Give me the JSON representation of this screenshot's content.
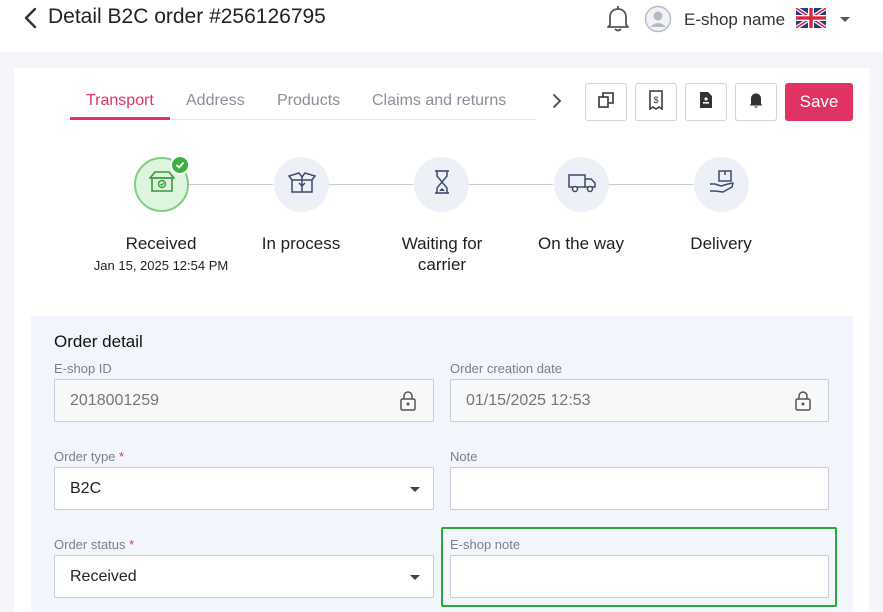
{
  "header": {
    "title": "Detail B2C order #256126795",
    "eshop_name": "E-shop name",
    "language_flag": "uk-flag-icon"
  },
  "tabs": [
    {
      "label": "Transport",
      "active": true
    },
    {
      "label": "Address",
      "active": false
    },
    {
      "label": "Products",
      "active": false
    },
    {
      "label": "Claims and returns",
      "active": false
    }
  ],
  "toolbar": {
    "buttons": [
      "copy-icon",
      "invoice-icon",
      "document-icon",
      "notification-icon"
    ],
    "save_label": "Save"
  },
  "steps": [
    {
      "label": "Received",
      "date": "Jan 15, 2025 12:54 PM",
      "done": true,
      "icon": "box-received-icon"
    },
    {
      "label": "In process",
      "icon": "box-open-icon"
    },
    {
      "label": "Waiting for carrier",
      "icon": "hourglass-icon"
    },
    {
      "label": "On the way",
      "icon": "truck-icon"
    },
    {
      "label": "Delivery",
      "icon": "hand-package-icon"
    }
  ],
  "order_detail": {
    "title": "Order detail",
    "eshop_id_label": "E-shop ID",
    "eshop_id_value": "2018001259",
    "creation_date_label": "Order creation date",
    "creation_date_value": "01/15/2025 12:53",
    "order_type_label": "Order type",
    "order_type_value": "B2C",
    "note_label": "Note",
    "note_value": "",
    "order_status_label": "Order status",
    "order_status_value": "Received",
    "eshop_note_label": "E-shop note",
    "eshop_note_value": "",
    "required_mark": "*"
  },
  "colors": {
    "accent": "#e03363",
    "success": "#3cb043",
    "highlight": "#2aa83a"
  }
}
